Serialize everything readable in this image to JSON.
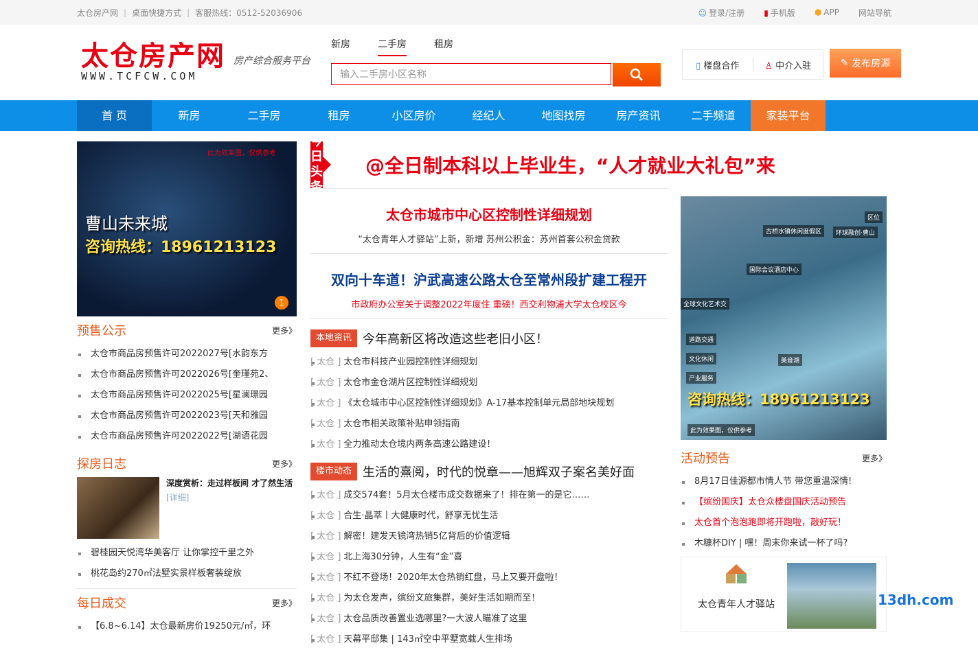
{
  "topbar": {
    "site": "太仓房产网",
    "shortcut": "桌面快捷方式",
    "hotline": "客服热线：0512-52036906",
    "login": "登录/注册",
    "mobile": "手机版",
    "app": "APP",
    "sitenav": "网站导航"
  },
  "logo": {
    "cn": "太仓房产网",
    "en": "WWW.TCFCW.COM",
    "slogan": "房产综合服务平台"
  },
  "search": {
    "tabs": [
      "新房",
      "二手房",
      "租房"
    ],
    "placeholder": "输入二手房小区名称"
  },
  "header_buttons": {
    "cooperate": "楼盘合作",
    "agent": "中介入驻",
    "publish": "发布房源"
  },
  "nav": [
    "首 页",
    "新房",
    "二手房",
    "租房",
    "小区房价",
    "经纪人",
    "地图找房",
    "房产资讯",
    "二手频道",
    "家装平台"
  ],
  "left": {
    "banner": {
      "top": "此为效果图，仅供参考",
      "title": "曹山未来城",
      "hotline": "咨询热线：18961213123",
      "page": "1"
    },
    "presale": {
      "title": "预售公示",
      "more": "更多》",
      "items": [
        "太仓市商品房预售许可2022027号[水韵东方",
        "太仓市商品房预售许可2022026号[奎瑾苑2、",
        "太仓市商品房预售许可2022025号[星澜璟园",
        "太仓市商品房预售许可2022023号[天和雅园",
        "太仓市商品房预售许可2022022号[湖语花园"
      ]
    },
    "diary": {
      "title": "探房日志",
      "more": "更多》",
      "feature_title": "深度赏析：走过样板间 才了然生活",
      "feature_detail": "[详细]",
      "items": [
        "碧桂园天悦湾华美客厅 让你掌控千里之外",
        "桃花岛约270㎡法墅实景样板奢装绽放"
      ]
    },
    "deals": {
      "title": "每日成交",
      "more": "更多》",
      "items": [
        "【6.8~6.14】太仓最新房价19250元/㎡，环"
      ]
    }
  },
  "mid": {
    "headline_badge": "今日 头条",
    "headline": "@全日制本科以上毕业生，“人才就业大礼包”来",
    "big1": "太仓市城市中心区控制性详细规划",
    "sub1": "“太仓青年人才驿站”上新，新增   苏州公积金：苏州首套公积金贷款",
    "big2": "双向十车道！沪武高速公路太仓至常州段扩建工程开",
    "sub2": "市政府办公室关于调整2022年度住    重磅！西交利物浦大学太仓校区今",
    "local": {
      "tag": "本地资讯",
      "head": "今年高新区将改造这些老旧小区！",
      "src": "[ 太仓 ]",
      "items": [
        "太仓市科技产业园控制性详细规划",
        "太仓市金仓湖片区控制性详细规划",
        "《太仓城市中心区控制性详细规划》A-17基本控制单元局部地块规划",
        "太仓市相关政策补贴申领指南",
        "全力推动太仓境内两条高速公路建设！"
      ]
    },
    "market": {
      "tag": "楼市动态",
      "head": "生活的熹阅，时代的悦章——旭辉双子案名美好面",
      "src": "[ 太仓 ]",
      "items": [
        "成交574套！5月太仓楼市成交数据来了！排在第一的是它……",
        "合生·晶萃丨大健康时代，舒享无忧生活",
        "解密！建发天镜湾热销5亿背后的价值逻辑",
        "北上海30分钟，人生有“金”喜",
        "不红不登场！2020年太仓热销红盘，马上又要开盘啦！",
        "为太仓发声，缤纷文旅集群，美好生活如期而至！",
        "太仓品质改善置业选哪里?一大波人瞄准了这里",
        "天幕平邸集 | 143㎡空中平墅宽载人生排场"
      ]
    }
  },
  "right": {
    "banner": {
      "hotline": "咨询热线：18961213123",
      "labels": [
        "古桥水镇休闲度假区",
        "环球融创·曹山",
        "国际会议酒店中心",
        "全球文化艺术交",
        "道路交通",
        "文化休闲",
        "产业服务",
        "美音湖",
        "此为效果图，仅供参考",
        "区位"
      ]
    },
    "events": {
      "title": "活动预告",
      "more": "更多》",
      "items": [
        "8月17日佳源都市情人节 带您重温深情!",
        "【缤纷国庆】太仓众楼盘国庆活动预告",
        "太仓首个泡泡跑即将开跑啦，敲好玩！",
        "木糠杯DIY | 嘿！周末你来试一杯了吗?"
      ]
    },
    "promo": {
      "logo_text": "太仓青年人才驿站"
    }
  },
  "watermark": "13dh.com",
  "colors": {
    "brand_red": "#e60012",
    "nav_blue": "#0d8fe8",
    "orange": "#f2772a"
  }
}
